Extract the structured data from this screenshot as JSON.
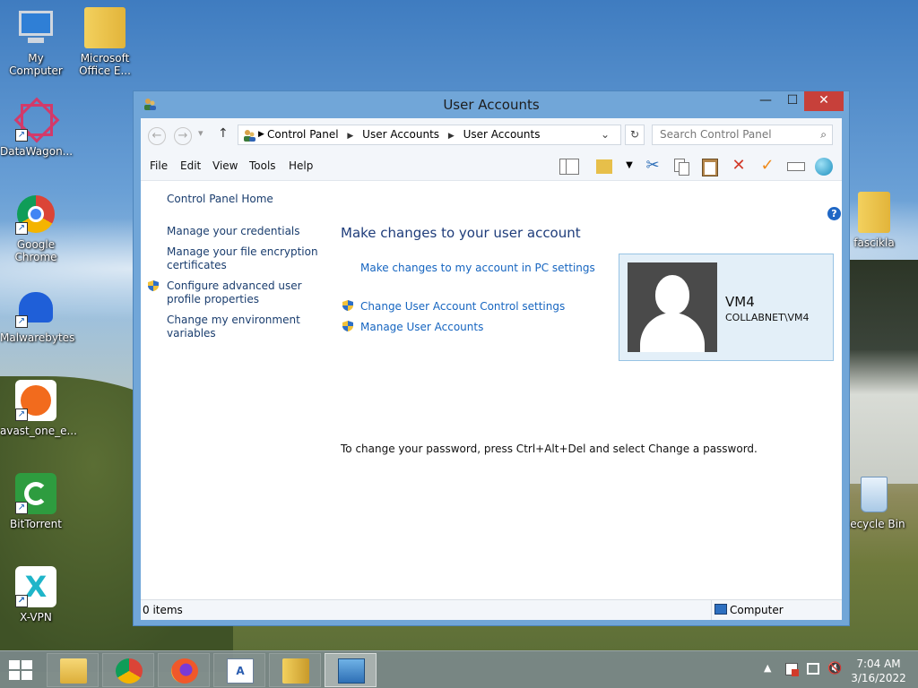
{
  "desktop": {
    "icons_left": [
      {
        "label": "My Computer"
      },
      {
        "label": "Microsoft Office E..."
      },
      {
        "label": "DataWagon..."
      },
      {
        "label": "Google Chrome"
      },
      {
        "label": "Malwarebytes"
      },
      {
        "label": "avast_one_e..."
      },
      {
        "label": "BitTorrent"
      },
      {
        "label": "X-VPN"
      }
    ],
    "icons_right": [
      {
        "label": "fascikla"
      },
      {
        "label": "Recycle Bin"
      }
    ]
  },
  "window": {
    "title": "User Accounts",
    "minimize_glyph": "—",
    "maximize_glyph": "☐",
    "close_glyph": "✕",
    "nav": {
      "back": "←",
      "forward": "→",
      "recent": "▾",
      "up": "↑",
      "dropdown": "⌄",
      "refresh": "↻"
    },
    "breadcrumb": [
      "Control Panel",
      "User Accounts",
      "User Accounts"
    ],
    "breadcrumb_sep": "▶",
    "search_placeholder": "Search Control Panel",
    "search_glyph": "⌕",
    "menu": [
      "File",
      "Edit",
      "View",
      "Tools",
      "Help"
    ],
    "sidebar": {
      "home": "Control Panel Home",
      "links": [
        "Manage your credentials",
        "Manage your file encryption certificates",
        "Configure advanced user profile properties",
        "Change my environment variables"
      ]
    },
    "main": {
      "heading": "Make changes to your user account",
      "link_pc_settings": "Make changes to my account in PC settings",
      "link_uac": "Change User Account Control settings",
      "link_manage": "Manage User Accounts",
      "note": "To change your password, press Ctrl+Alt+Del and select Change a password.",
      "help_glyph": "?"
    },
    "user": {
      "name": "VM4",
      "domain": "COLLABNET\\VM4"
    },
    "status": {
      "items": "0 items",
      "location": "Computer"
    }
  },
  "taskbar": {
    "clock_time": "7:04 AM",
    "clock_date": "3/16/2022",
    "tray_chevron": "▲"
  },
  "colors": {
    "link": "#1665c0",
    "heading": "#1e3c7a",
    "window_frame": "#71a6d8",
    "close_button": "#c7403a"
  }
}
